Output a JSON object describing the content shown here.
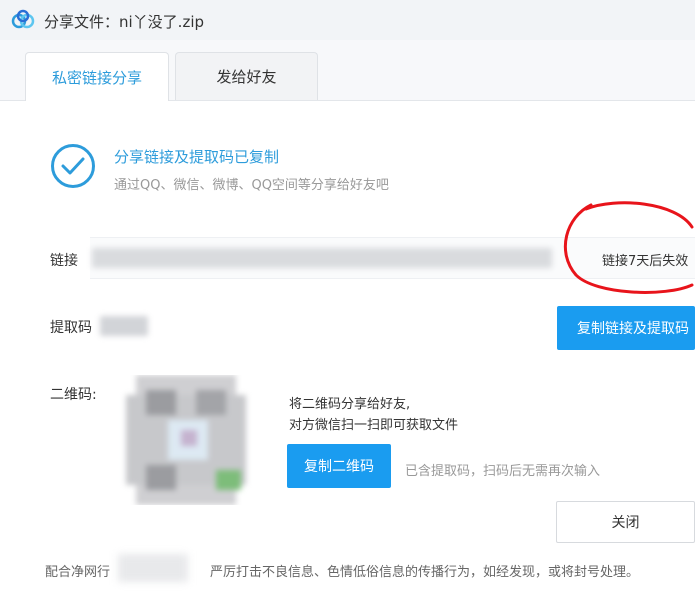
{
  "window": {
    "title": "分享文件：ni丫没了.zip"
  },
  "tabs": [
    {
      "label": "私密链接分享",
      "active": true
    },
    {
      "label": "发给好友",
      "active": false
    }
  ],
  "status": {
    "title": "分享链接及提取码已复制",
    "subtitle": "通过QQ、微信、微博、QQ空间等分享给好友吧"
  },
  "link": {
    "label": "链接",
    "expire": "链接7天后失效"
  },
  "code": {
    "label": "提取码"
  },
  "qr": {
    "label": "二维码:",
    "desc_line1": "将二维码分享给好友,",
    "desc_line2": "对方微信扫一扫即可获取文件",
    "note": "已含提取码，扫码后无需再次输入"
  },
  "buttons": {
    "copy_link": "复制链接及提取码",
    "copy_qr": "复制二维码",
    "close": "关闭"
  },
  "footer": {
    "prefix": "配合净网行",
    "suffix": "严厉打击不良信息、色情低俗信息的传播行为，如经发现，或将封号处理。"
  },
  "colors": {
    "accent": "#2d9cdb",
    "primary_button": "#1a9cf0",
    "annotation": "#e8141b"
  }
}
